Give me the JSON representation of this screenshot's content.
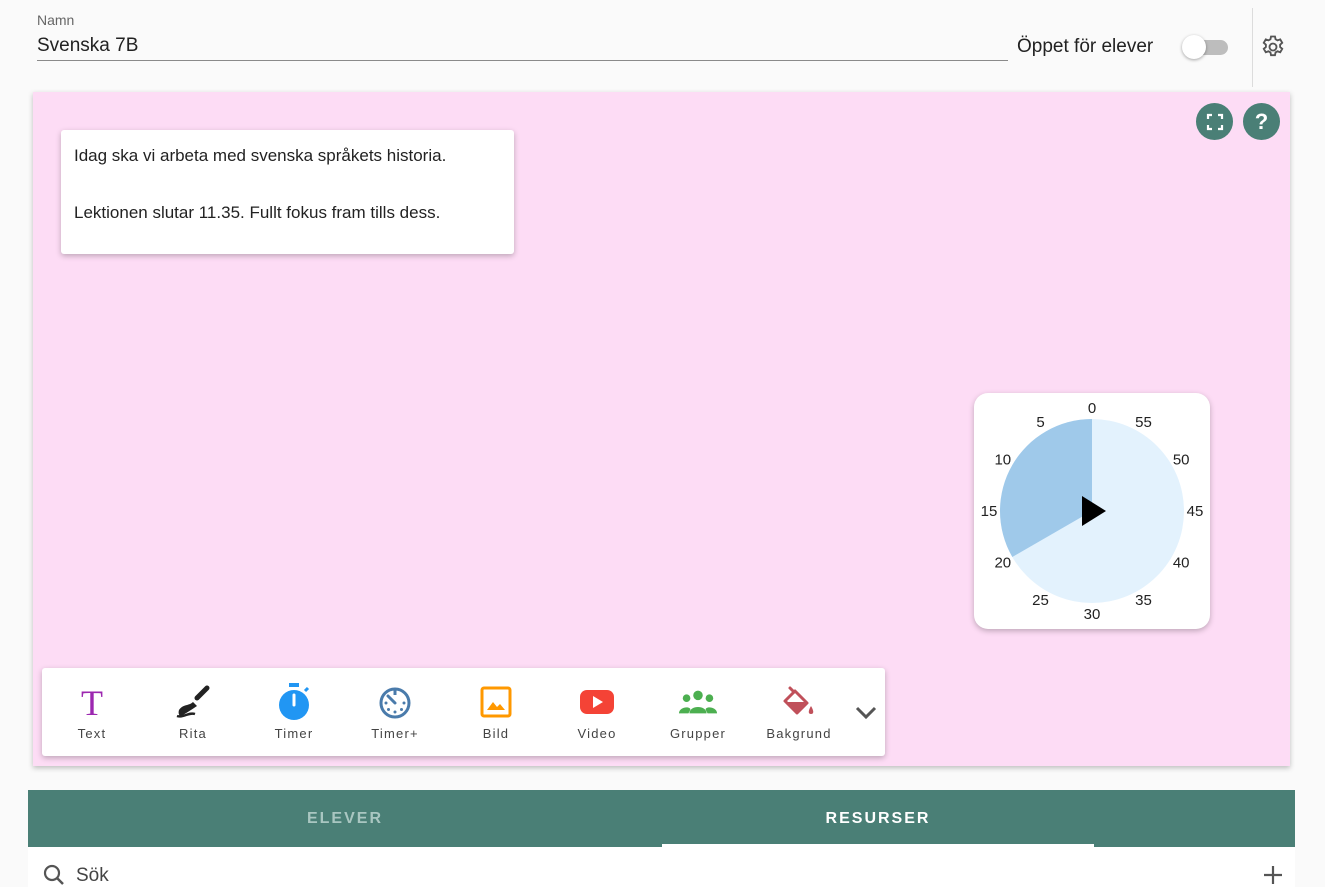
{
  "header": {
    "name_label": "Namn",
    "name_value": "Svenska 7B",
    "open_label": "Öppet för elever",
    "open_enabled": false,
    "settings_icon": "gear-icon"
  },
  "board": {
    "background_color": "#fddcf5",
    "fullscreen_icon": "fullscreen-icon",
    "help_label": "?",
    "note": {
      "line1": "Idag ska vi arbeta med svenska språkets historia.",
      "line2": "Lektionen slutar 11.35. Fullt fokus fram tills dess."
    },
    "timer": {
      "dial_numbers": [
        "0",
        "5",
        "10",
        "15",
        "20",
        "25",
        "30",
        "35",
        "40",
        "45",
        "50",
        "55"
      ],
      "remaining_minutes": 20,
      "play_icon": "play-icon"
    }
  },
  "toolbar": {
    "tools": [
      {
        "label": "Text",
        "icon": "text-icon",
        "color": "#9c27b0"
      },
      {
        "label": "Rita",
        "icon": "brush-icon",
        "color": "#222222"
      },
      {
        "label": "Timer",
        "icon": "timer-icon",
        "color": "#2196f3"
      },
      {
        "label": "Timer+",
        "icon": "timer-plus-icon",
        "color": "#4a7bab"
      },
      {
        "label": "Bild",
        "icon": "image-icon",
        "color": "#ff9800"
      },
      {
        "label": "Video",
        "icon": "youtube-icon",
        "color": "#f44336"
      },
      {
        "label": "Grupper",
        "icon": "groups-icon",
        "color": "#4caf50"
      },
      {
        "label": "Bakgrund",
        "icon": "paint-bucket-icon",
        "color": "#c0505a"
      }
    ],
    "more_icon": "chevron-down-icon"
  },
  "tabs": {
    "items": [
      "ELEVER",
      "RESURSER"
    ],
    "active": "RESURSER"
  },
  "search": {
    "placeholder": "Sök"
  },
  "colors": {
    "accent": "#4a7f76"
  }
}
